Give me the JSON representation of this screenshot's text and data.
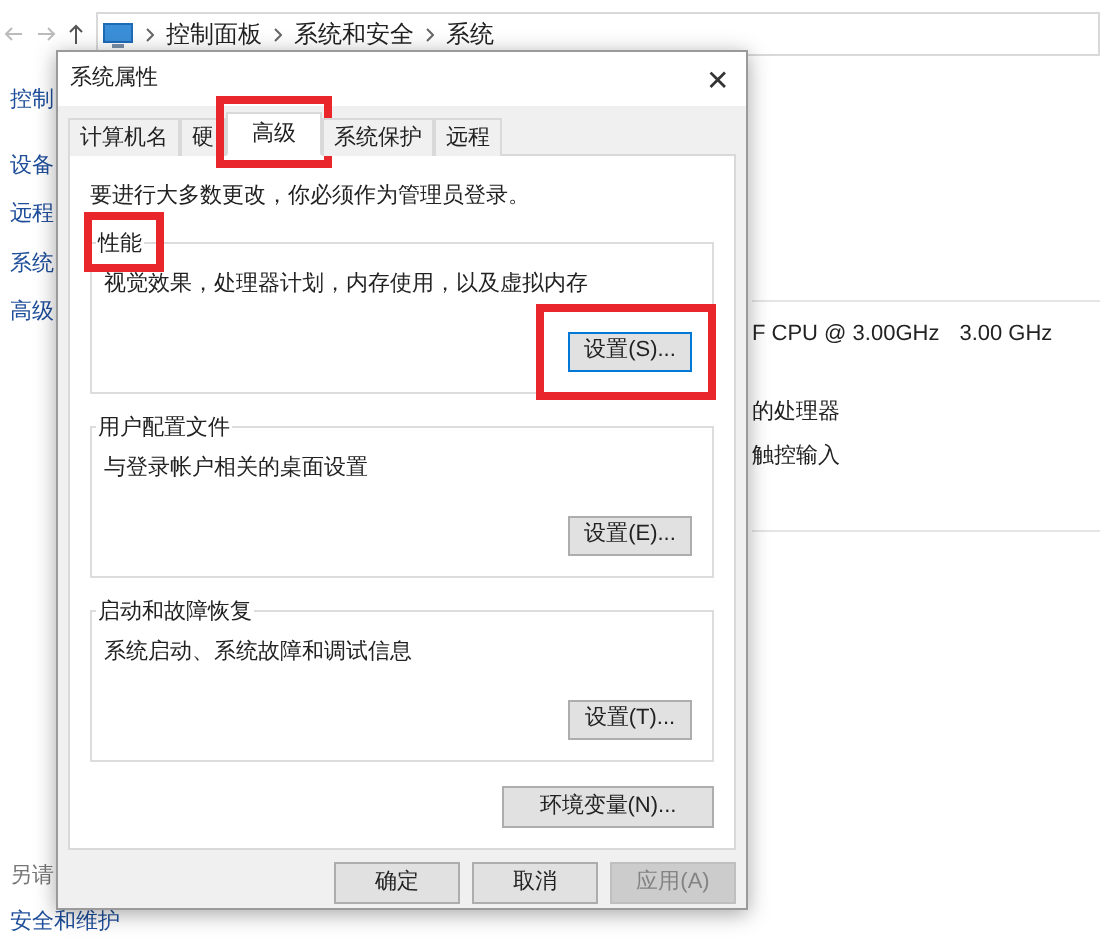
{
  "explorer": {
    "breadcrumbs": [
      "控制面板",
      "系统和安全",
      "系统"
    ],
    "sidebar_links": [
      "控制",
      "设备",
      "远程",
      "系统",
      "高级"
    ],
    "see_also": {
      "heading": "另请",
      "links": [
        "安全和维护"
      ]
    },
    "details": [
      {
        "texts": [
          "F CPU @ 3.00GHz",
          "3.00 GHz"
        ]
      },
      {
        "texts": [
          "的处理器"
        ]
      },
      {
        "texts": [
          "触控输入"
        ]
      }
    ]
  },
  "dialog": {
    "title": "系统属性",
    "close": "✕",
    "tabs": [
      {
        "label": "计算机名",
        "selected": false,
        "highlighted": false
      },
      {
        "label": "硬",
        "selected": false,
        "highlighted": false
      },
      {
        "label": "高级",
        "selected": true,
        "highlighted": true
      },
      {
        "label": "系统保护",
        "selected": false,
        "highlighted": false
      },
      {
        "label": "远程",
        "selected": false,
        "highlighted": false
      }
    ],
    "notice": "要进行大多数更改，你必须作为管理员登录。",
    "groups": [
      {
        "title": "性能",
        "title_highlighted": true,
        "description": "视觉效果，处理器计划，内存使用，以及虚拟内存",
        "button": {
          "label": "设置(S)...",
          "default": true,
          "highlighted": true
        }
      },
      {
        "title": "用户配置文件",
        "title_highlighted": false,
        "description": "与登录帐户相关的桌面设置",
        "button": {
          "label": "设置(E)...",
          "default": false,
          "highlighted": false
        }
      },
      {
        "title": "启动和故障恢复",
        "title_highlighted": false,
        "description": "系统启动、系统故障和调试信息",
        "button": {
          "label": "设置(T)...",
          "default": false,
          "highlighted": false
        }
      }
    ],
    "env_button": "环境变量(N)...",
    "buttons": [
      {
        "label": "确定",
        "disabled": false
      },
      {
        "label": "取消",
        "disabled": false
      },
      {
        "label": "应用(A)",
        "disabled": true
      }
    ]
  }
}
